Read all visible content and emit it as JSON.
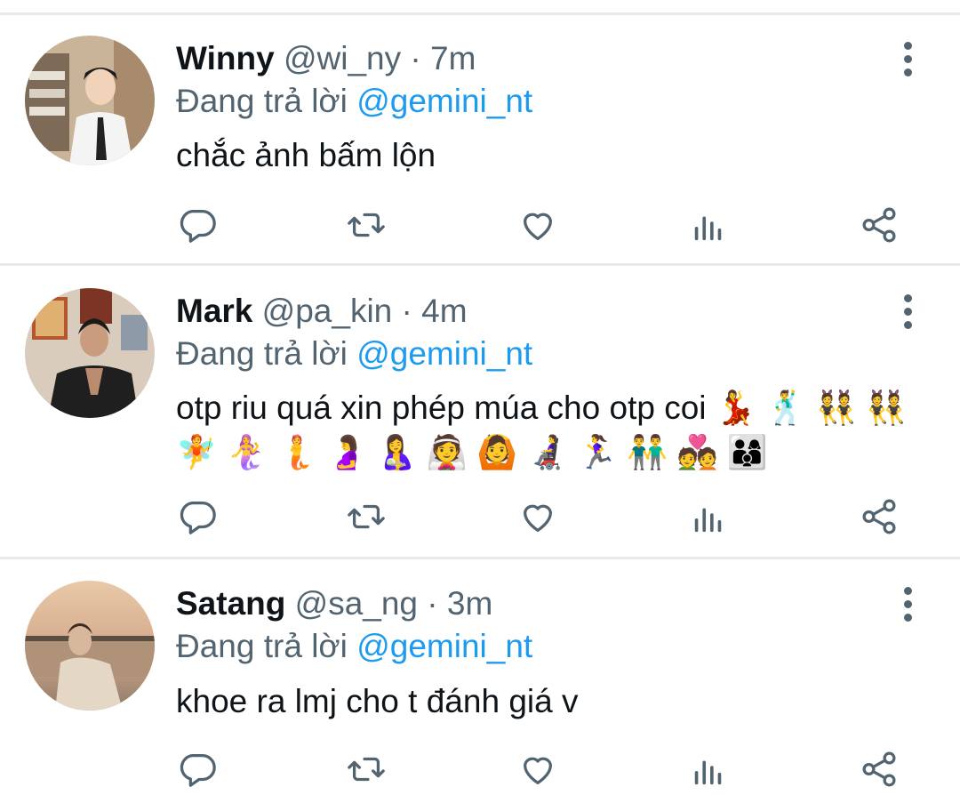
{
  "reply_prefix": "Đang trả lời",
  "tweets": [
    {
      "name": "Winny",
      "handle": "@wi_ny",
      "time": "7m",
      "reply_to": "@gemini_nt",
      "text": "chắc ảnh bấm lộn"
    },
    {
      "name": "Mark",
      "handle": "@pa_kin",
      "time": "4m",
      "reply_to": "@gemini_nt",
      "text": "otp riu quá xin phép múa cho otp coi 💃 🕺 👯 👯 🧚 🧜‍♀️ 🧜 🤰 🤱 👰 🙆 👩‍🦼 🏃‍♀️ 👬 💑 👨‍👩‍👦"
    },
    {
      "name": "Satang",
      "handle": "@sa_ng",
      "time": "3m",
      "reply_to": "@gemini_nt",
      "text": "khoe ra lmj cho t đánh giá v"
    }
  ],
  "icons": [
    "reply-icon",
    "retweet-icon",
    "like-icon",
    "views-icon",
    "share-icon",
    "more-icon"
  ],
  "colors": {
    "accent": "#1d9bf0",
    "muted": "#536471",
    "text": "#0f1419",
    "divider": "#e7e9ea"
  }
}
